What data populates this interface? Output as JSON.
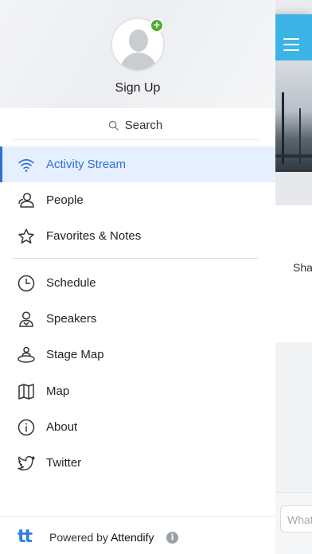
{
  "profile": {
    "signup_label": "Sign Up",
    "add_badge": "+"
  },
  "search": {
    "label": "Search"
  },
  "nav": {
    "items": [
      {
        "label": "Activity Stream",
        "icon": "wifi-icon",
        "active": true
      },
      {
        "label": "People",
        "icon": "person-icon"
      },
      {
        "label": "Favorites & Notes",
        "icon": "star-icon"
      },
      {
        "label": "Schedule",
        "icon": "clock-icon"
      },
      {
        "label": "Speakers",
        "icon": "speaker-person-icon"
      },
      {
        "label": "Stage Map",
        "icon": "stage-map-icon"
      },
      {
        "label": "Map",
        "icon": "map-icon"
      },
      {
        "label": "About",
        "icon": "info-icon"
      },
      {
        "label": "Twitter",
        "icon": "twitter-icon"
      }
    ]
  },
  "footer": {
    "logo": "tt",
    "powered_prefix": "Powered by ",
    "brand": "Attendify",
    "info_icon": "i"
  },
  "background_app": {
    "card_text": "Shar",
    "compose_placeholder": "What"
  },
  "colors": {
    "accent": "#2f6fd6",
    "header": "#3bb4e5",
    "badge": "#4caf2b"
  }
}
